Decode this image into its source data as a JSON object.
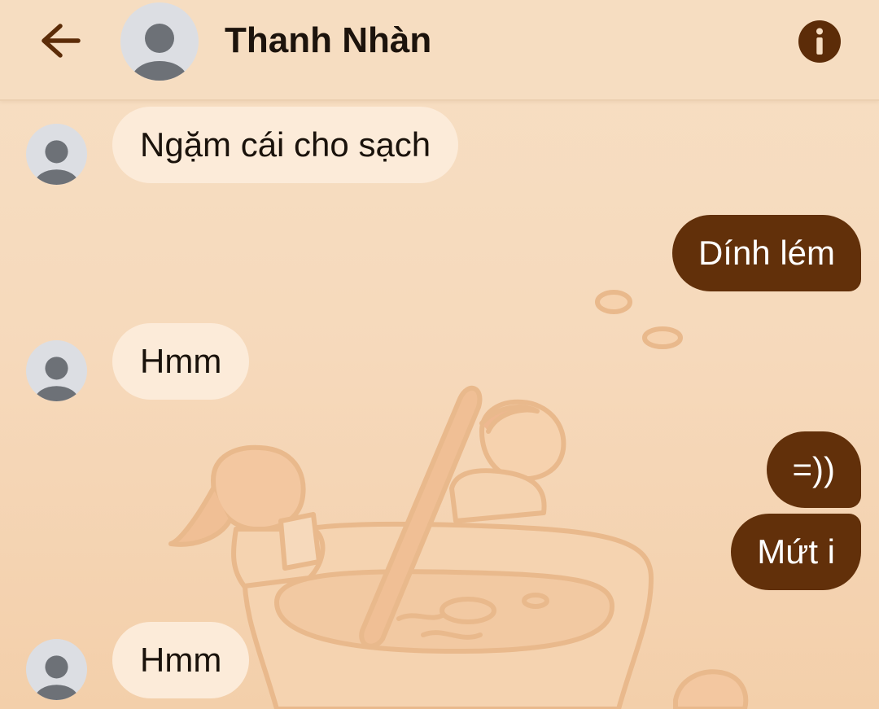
{
  "header": {
    "back_icon": "arrow-left-icon",
    "contact_name": "Thanh Nhàn",
    "avatar_icon": "person-avatar-icon",
    "info_icon": "info-icon"
  },
  "colors": {
    "background": "#f6dcbf",
    "incoming_bubble": "#fcebd9",
    "outgoing_bubble": "#62300a",
    "accent": "#5c2c08"
  },
  "messages": [
    {
      "direction": "incoming",
      "text": "Ngặm cái cho sạch",
      "avatar": "person-avatar-icon"
    },
    {
      "direction": "outgoing",
      "text": "Dính lém"
    },
    {
      "direction": "incoming",
      "text": "Hmm",
      "avatar": "person-avatar-icon"
    },
    {
      "direction": "outgoing",
      "text": "=))"
    },
    {
      "direction": "outgoing",
      "text": "Mứt i"
    },
    {
      "direction": "incoming",
      "text": "Hmm",
      "avatar": "person-avatar-icon"
    }
  ]
}
